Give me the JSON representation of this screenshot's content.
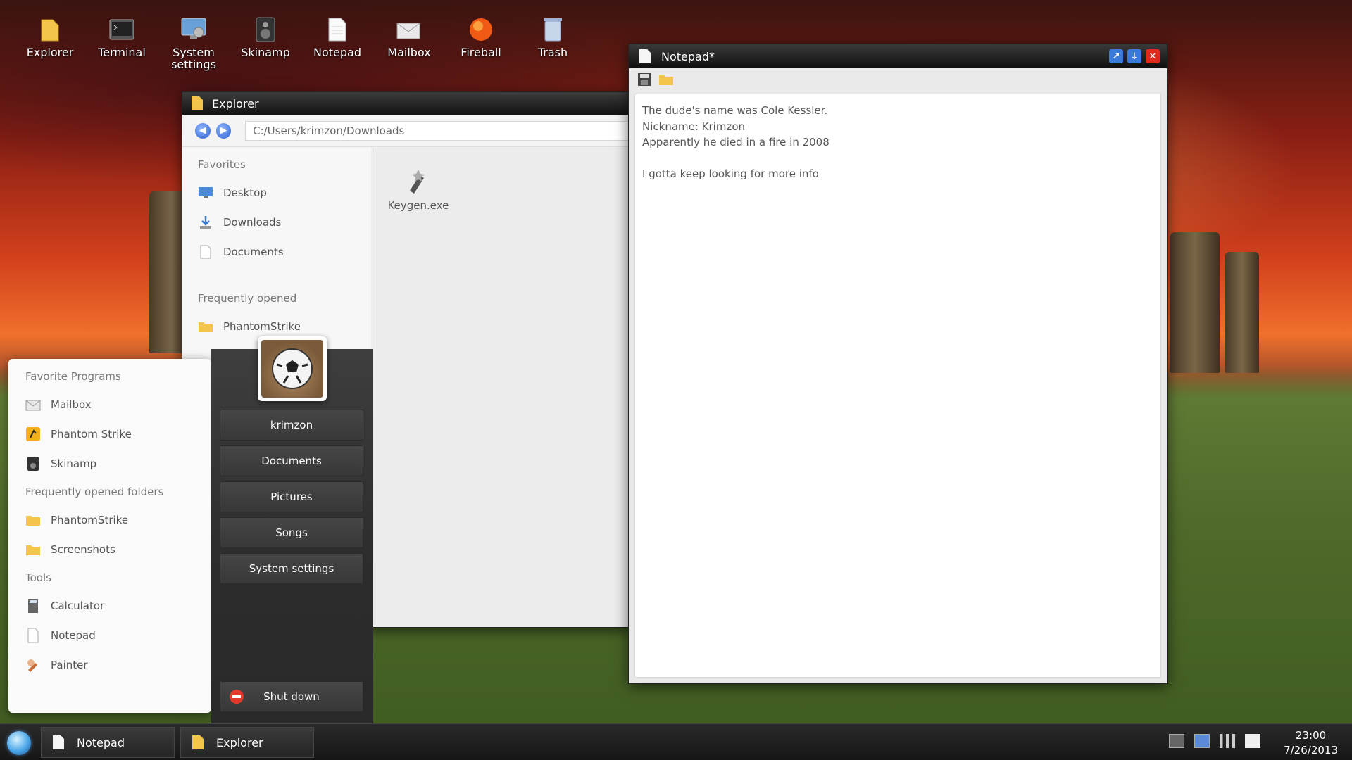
{
  "desktop": {
    "icons": [
      {
        "label": "Explorer"
      },
      {
        "label": "Terminal"
      },
      {
        "label": "System settings"
      },
      {
        "label": "Skinamp"
      },
      {
        "label": "Notepad"
      },
      {
        "label": "Mailbox"
      },
      {
        "label": "Fireball"
      },
      {
        "label": "Trash"
      }
    ]
  },
  "explorer": {
    "title": "Explorer",
    "path": "C:/Users/krimzon/Downloads",
    "favorites_heading": "Favorites",
    "favorites": [
      {
        "label": "Desktop"
      },
      {
        "label": "Downloads"
      },
      {
        "label": "Documents"
      }
    ],
    "frequent_heading": "Frequently opened",
    "frequent": [
      {
        "label": "PhantomStrike"
      }
    ],
    "files": [
      {
        "label": "Keygen.exe"
      }
    ]
  },
  "notepad": {
    "title": "Notepad*",
    "lines": [
      "The dude's name was Cole Kessler.",
      "Nickname: Krimzon",
      "Apparently he died in a fire in 2008",
      "",
      "I gotta keep looking for more info"
    ]
  },
  "start_menu": {
    "favorite_heading": "Favorite Programs",
    "favorites": [
      {
        "label": "Mailbox"
      },
      {
        "label": "Phantom Strike"
      },
      {
        "label": "Skinamp"
      }
    ],
    "folders_heading": "Frequently opened folders",
    "folders": [
      {
        "label": "PhantomStrike"
      },
      {
        "label": "Screenshots"
      }
    ],
    "tools_heading": "Tools",
    "tools": [
      {
        "label": "Calculator"
      },
      {
        "label": "Notepad"
      },
      {
        "label": "Painter"
      }
    ],
    "user": {
      "name": "krimzon"
    },
    "right_buttons": [
      {
        "label": "krimzon"
      },
      {
        "label": "Documents"
      },
      {
        "label": "Pictures"
      },
      {
        "label": "Songs"
      },
      {
        "label": "System settings"
      }
    ],
    "shutdown_label": "Shut down"
  },
  "taskbar": {
    "tasks": [
      {
        "label": "Notepad"
      },
      {
        "label": "Explorer"
      }
    ],
    "time": "23:00",
    "date": "7/26/2013"
  }
}
